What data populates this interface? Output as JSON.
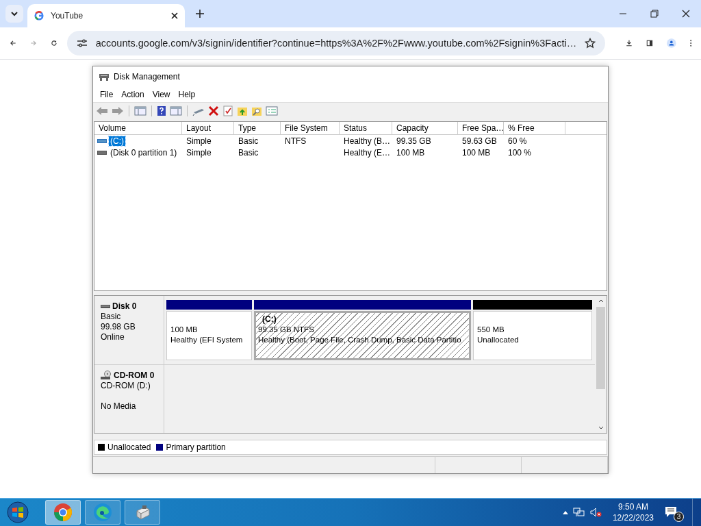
{
  "browser": {
    "tab": {
      "title": "YouTube"
    },
    "address": "accounts.google.com/v3/signin/identifier?continue=https%3A%2F%2Fwww.youtube.com%2Fsignin%3Facti…"
  },
  "window": {
    "title": "Disk Management",
    "menu": [
      "File",
      "Action",
      "View",
      "Help"
    ]
  },
  "volumes": {
    "columns": [
      "Volume",
      "Layout",
      "Type",
      "File System",
      "Status",
      "Capacity",
      "Free Spa…",
      "% Free"
    ],
    "rows": [
      {
        "selected": true,
        "cells": [
          "(C:)",
          "Simple",
          "Basic",
          "NTFS",
          "Healthy (B…",
          "99.35 GB",
          "59.63 GB",
          "60 %"
        ]
      },
      {
        "selected": false,
        "cells": [
          "(Disk 0 partition 1)",
          "Simple",
          "Basic",
          "",
          "Healthy (E…",
          "100 MB",
          "100 MB",
          "100 %"
        ]
      }
    ]
  },
  "disks": [
    {
      "kind": "disk",
      "name": "Disk 0",
      "lines": [
        "Basic",
        "99.98 GB"
      ],
      "status": "Online",
      "partitions": [
        {
          "size": "100 MB",
          "status": "Healthy (EFI System",
          "color": "#00007f",
          "selected": false
        },
        {
          "label": "(C:)",
          "size": "99.35 GB NTFS",
          "status": "Healthy (Boot, Page File, Crash Dump, Basic Data Partitio",
          "color": "#00007f",
          "selected": true
        },
        {
          "size": "550 MB",
          "status": "Unallocated",
          "color": "#000000",
          "selected": false
        }
      ]
    },
    {
      "kind": "cdrom",
      "name": "CD-ROM 0",
      "lines": [
        "CD-ROM (D:)"
      ],
      "status": "No Media"
    }
  ],
  "legend": [
    {
      "label": "Unallocated",
      "color": "#000000"
    },
    {
      "label": "Primary partition",
      "color": "#00007f"
    }
  ],
  "taskbar": {
    "time": "9:50 AM",
    "date": "12/22/2023",
    "volume_muted": true,
    "notifications": "3"
  }
}
